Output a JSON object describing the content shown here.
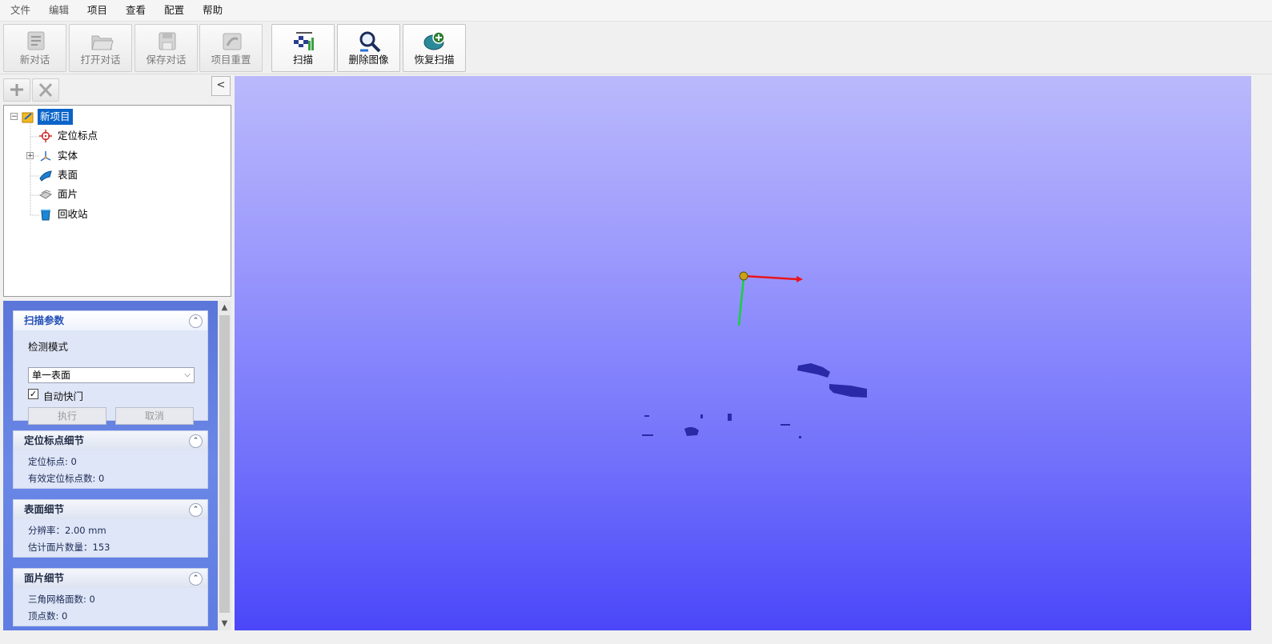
{
  "menu": [
    "文件",
    "编辑",
    "项目",
    "查看",
    "配置",
    "帮助"
  ],
  "toolbar": {
    "new_session": "新对话",
    "open_session": "打开对话",
    "save_session": "保存对话",
    "project_reset": "项目重置",
    "scan": "扫描",
    "delete_image": "删除图像",
    "restore_scan": "恢复扫描"
  },
  "panel": {
    "collapse_label": "<"
  },
  "tree": {
    "root": "新项目",
    "children": [
      "定位标点",
      "实体",
      "表面",
      "面片",
      "回收站"
    ]
  },
  "scan_params": {
    "title": "扫描参数",
    "mode_label": "检测模式",
    "mode_value": "单一表面",
    "auto_shutter_label": "自动快门",
    "auto_shutter_checked": true,
    "execute_label": "执行",
    "cancel_label": "取消"
  },
  "marker_details": {
    "title": "定位标点细节",
    "markers": "定位标点: 0",
    "valid_markers": "有效定位标点数: 0"
  },
  "surface_details": {
    "title": "表面细节",
    "resolution": "分辨率：2.00 mm",
    "est_patches": "估计面片数量：153"
  },
  "patch_details": {
    "title": "面片细节",
    "triangles": "三角网格面数: 0",
    "vertices": "顶点数: 0"
  },
  "colors": {
    "viewport_top": "#bab9fc",
    "viewport_bottom": "#4b47f9",
    "selection": "#0a64c8"
  }
}
